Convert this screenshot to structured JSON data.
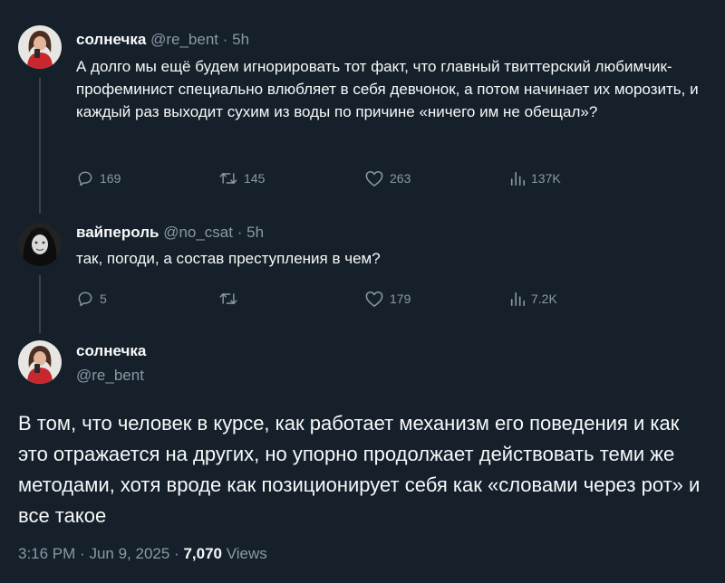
{
  "tweets": [
    {
      "name": "солнечка",
      "handle": "@re_bent",
      "separator": "·",
      "time": "5h",
      "text": "А долго мы ещё будем игнорировать тот факт, что главный твиттерский любимчик-профеминист специально влюбляет в себя девчонок, а потом начинает их морозить, и каждый раз выходит сухим из воды по причине «ничего им не обещал»?",
      "replies": "169",
      "retweets": "145",
      "likes": "263",
      "views": "137K"
    },
    {
      "name": "вайпероль",
      "handle": "@no_csat",
      "separator": "·",
      "time": "5h",
      "text": "так, погоди, а состав преступления в чем?",
      "replies": "5",
      "retweets": "",
      "likes": "179",
      "views": "7.2K"
    }
  ],
  "main_tweet": {
    "name": "солнечка",
    "handle": "@re_bent",
    "text": "В том, что человек в курсе, как работает механизм его поведения и как это отражается на других, но упорно продолжает действовать теми же методами, хотя вроде как позиционирует себя как «словами через рот» и все такое",
    "time": "3:16 PM",
    "date": "Jun 9, 2025",
    "dot": "·",
    "views_count": "7,070",
    "views_label": "Views"
  },
  "colors": {
    "background": "#15202b",
    "text": "#f7f9f9",
    "secondary": "#8b98a5",
    "thread_line": "#38444d"
  },
  "icons": [
    "reply-icon",
    "retweet-icon",
    "like-icon",
    "views-icon"
  ]
}
